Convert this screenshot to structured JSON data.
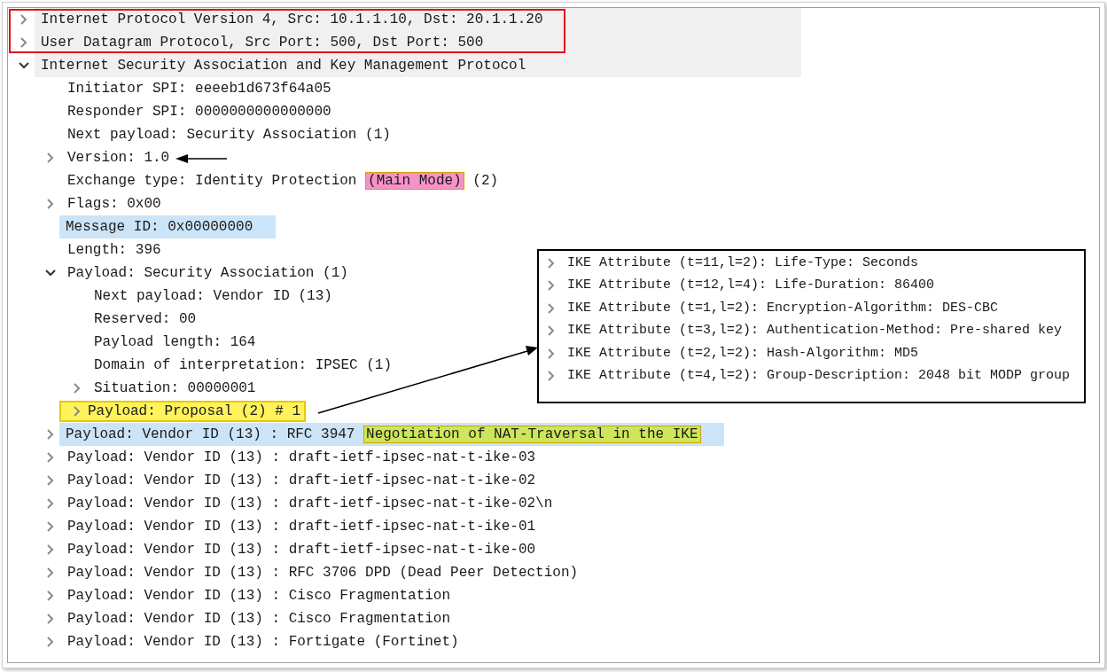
{
  "tree": [
    {
      "label": "Internet Protocol Version 4, Src: 10.1.1.10, Dst: 20.1.1.20",
      "expanded": false,
      "kind": "outlined"
    },
    {
      "label": "User Datagram Protocol, Src Port: 500, Dst Port: 500",
      "expanded": false,
      "kind": "outlined"
    },
    {
      "label": "Internet Security Association and Key Management Protocol",
      "expanded": true,
      "kind": "shaded",
      "children": [
        {
          "label": "Initiator SPI: eeeeb1d673f64a05"
        },
        {
          "label": "Responder SPI: 0000000000000000"
        },
        {
          "label": "Next payload: Security Association (1)"
        },
        {
          "label": "Version: 1.0",
          "expanded": false
        },
        {
          "parts": [
            {
              "text": "Exchange type: Identity Protection "
            },
            {
              "text": "(Main Mode)",
              "color": "#f791c8"
            },
            {
              "text": " (2)"
            }
          ]
        },
        {
          "label": "Flags: 0x00",
          "expanded": false
        },
        {
          "label": "Message ID: 0x00000000",
          "kind": "selected"
        },
        {
          "label": "Length: 396"
        },
        {
          "label": "Payload: Security Association (1)",
          "expanded": true,
          "children": [
            {
              "label": "Next payload: Vendor ID (13)"
            },
            {
              "label": "Reserved: 00"
            },
            {
              "label": "Payload length: 164"
            },
            {
              "label": "Domain of interpretation: IPSEC (1)"
            },
            {
              "label": "Situation: 00000001",
              "expanded": false
            },
            {
              "label": "Payload: Proposal (2) # 1",
              "expanded": false,
              "kind": "boxed"
            }
          ]
        },
        {
          "parts": [
            {
              "text": "Payload: Vendor ID (13) : RFC 3947 "
            },
            {
              "text": "Negotiation of NAT-Traversal in the IKE",
              "color": "#cde65c"
            }
          ],
          "expanded": false,
          "kind": "selected"
        },
        {
          "label": "Payload: Vendor ID (13) : draft-ietf-ipsec-nat-t-ike-03",
          "expanded": false
        },
        {
          "label": "Payload: Vendor ID (13) : draft-ietf-ipsec-nat-t-ike-02",
          "expanded": false
        },
        {
          "label": "Payload: Vendor ID (13) : draft-ietf-ipsec-nat-t-ike-02\\n",
          "expanded": false
        },
        {
          "label": "Payload: Vendor ID (13) : draft-ietf-ipsec-nat-t-ike-01",
          "expanded": false
        },
        {
          "label": "Payload: Vendor ID (13) : draft-ietf-ipsec-nat-t-ike-00",
          "expanded": false
        },
        {
          "label": "Payload: Vendor ID (13) : RFC 3706 DPD (Dead Peer Detection)",
          "expanded": false
        },
        {
          "label": "Payload: Vendor ID (13) : Cisco Fragmentation",
          "expanded": false
        },
        {
          "label": "Payload: Vendor ID (13) : Cisco Fragmentation",
          "expanded": false
        },
        {
          "label": "Payload: Vendor ID (13) : Fortigate (Fortinet)",
          "expanded": false
        }
      ]
    }
  ],
  "inset": {
    "rows": [
      {
        "label": "IKE Attribute (t=11,l=2): Life-Type: Seconds",
        "expanded": false
      },
      {
        "label": "IKE Attribute (t=12,l=4): Life-Duration: 86400",
        "expanded": false
      },
      {
        "label": "IKE Attribute (t=1,l=2): Encryption-Algorithm: DES-CBC",
        "expanded": false
      },
      {
        "label": "IKE Attribute (t=3,l=2): Authentication-Method: Pre-shared key",
        "expanded": false
      },
      {
        "label": "IKE Attribute (t=2,l=2): Hash-Algorithm: MD5",
        "expanded": false
      },
      {
        "label": "IKE Attribute (t=4,l=2): Group-Description: 2048 bit MODP group",
        "expanded": false
      }
    ]
  }
}
